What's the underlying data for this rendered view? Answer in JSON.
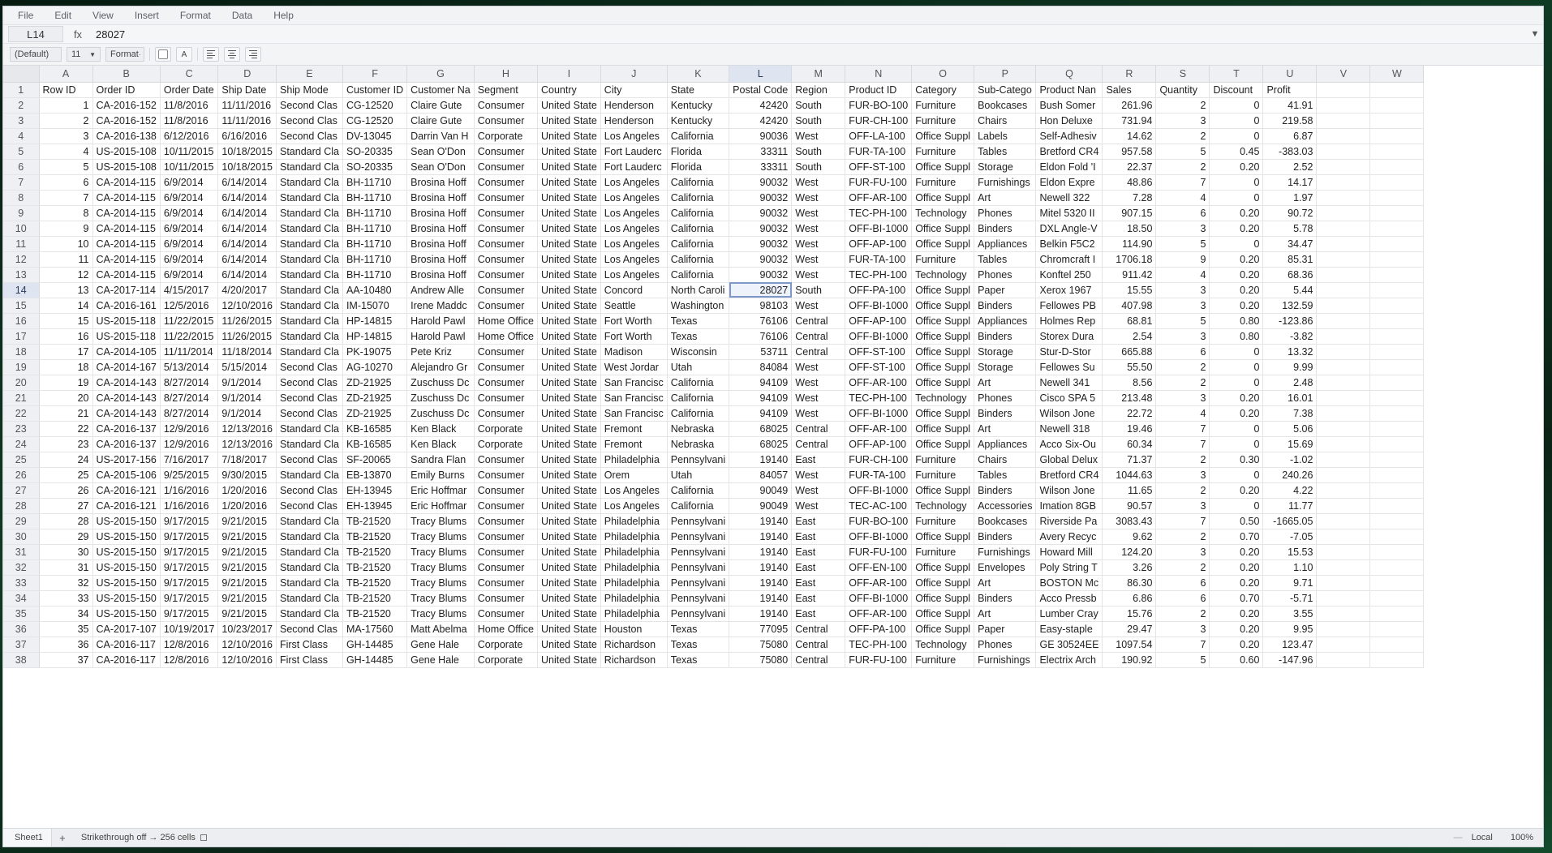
{
  "menu": [
    "File",
    "Edit",
    "View",
    "Insert",
    "Format",
    "Data",
    "Help"
  ],
  "formula_bar": {
    "cell_ref": "L14",
    "fx_label": "fx",
    "value": "28027",
    "collapse_icon": "triangle-down-icon"
  },
  "toolbar": {
    "style_label": "(Default)",
    "font_size": "11",
    "format_label": "Format",
    "color_button": "A"
  },
  "columns": [
    "A",
    "B",
    "C",
    "D",
    "E",
    "F",
    "G",
    "H",
    "I",
    "J",
    "K",
    "L",
    "M",
    "N",
    "O",
    "P",
    "Q",
    "R",
    "S",
    "T",
    "U",
    "V",
    "W"
  ],
  "selected_column": "L",
  "selected_row": 14,
  "header_row": [
    "Row ID",
    "Order ID",
    "Order Date",
    "Ship Date",
    "Ship Mode",
    "Customer ID",
    "Customer Na",
    "Segment",
    "Country",
    "City",
    "State",
    "Postal Code",
    "Region",
    "Product ID",
    "Category",
    "Sub-Catego",
    "Product Nan",
    "Sales",
    "Quantity",
    "Discount",
    "Profit",
    "",
    ""
  ],
  "rows": [
    [
      "1",
      "CA-2016-152",
      "11/8/2016",
      "11/11/2016",
      "Second Clas",
      "CG-12520",
      "Claire Gute",
      "Consumer",
      "United State",
      "Henderson",
      "Kentucky",
      "42420",
      "South",
      "FUR-BO-100",
      "Furniture",
      "Bookcases",
      "Bush Somer",
      "261.96",
      "2",
      "0",
      "41.91"
    ],
    [
      "2",
      "CA-2016-152",
      "11/8/2016",
      "11/11/2016",
      "Second Clas",
      "CG-12520",
      "Claire Gute",
      "Consumer",
      "United State",
      "Henderson",
      "Kentucky",
      "42420",
      "South",
      "FUR-CH-100",
      "Furniture",
      "Chairs",
      "Hon Deluxe",
      "731.94",
      "3",
      "0",
      "219.58"
    ],
    [
      "3",
      "CA-2016-138",
      "6/12/2016",
      "6/16/2016",
      "Second Clas",
      "DV-13045",
      "Darrin Van H",
      "Corporate",
      "United State",
      "Los Angeles",
      "California",
      "90036",
      "West",
      "OFF-LA-100",
      "Office Suppl",
      "Labels",
      "Self-Adhesiv",
      "14.62",
      "2",
      "0",
      "6.87"
    ],
    [
      "4",
      "US-2015-108",
      "10/11/2015",
      "10/18/2015",
      "Standard Cla",
      "SO-20335",
      "Sean O'Don",
      "Consumer",
      "United State",
      "Fort Lauderc",
      "Florida",
      "33311",
      "South",
      "FUR-TA-100",
      "Furniture",
      "Tables",
      "Bretford CR4",
      "957.58",
      "5",
      "0.45",
      "-383.03"
    ],
    [
      "5",
      "US-2015-108",
      "10/11/2015",
      "10/18/2015",
      "Standard Cla",
      "SO-20335",
      "Sean O'Don",
      "Consumer",
      "United State",
      "Fort Lauderc",
      "Florida",
      "33311",
      "South",
      "OFF-ST-100",
      "Office Suppl",
      "Storage",
      "Eldon Fold 'I",
      "22.37",
      "2",
      "0.20",
      "2.52"
    ],
    [
      "6",
      "CA-2014-115",
      "6/9/2014",
      "6/14/2014",
      "Standard Cla",
      "BH-11710",
      "Brosina Hoff",
      "Consumer",
      "United State",
      "Los Angeles",
      "California",
      "90032",
      "West",
      "FUR-FU-100",
      "Furniture",
      "Furnishings",
      "Eldon Expre",
      "48.86",
      "7",
      "0",
      "14.17"
    ],
    [
      "7",
      "CA-2014-115",
      "6/9/2014",
      "6/14/2014",
      "Standard Cla",
      "BH-11710",
      "Brosina Hoff",
      "Consumer",
      "United State",
      "Los Angeles",
      "California",
      "90032",
      "West",
      "OFF-AR-100",
      "Office Suppl",
      "Art",
      "Newell 322",
      "7.28",
      "4",
      "0",
      "1.97"
    ],
    [
      "8",
      "CA-2014-115",
      "6/9/2014",
      "6/14/2014",
      "Standard Cla",
      "BH-11710",
      "Brosina Hoff",
      "Consumer",
      "United State",
      "Los Angeles",
      "California",
      "90032",
      "West",
      "TEC-PH-100",
      "Technology",
      "Phones",
      "Mitel 5320 II",
      "907.15",
      "6",
      "0.20",
      "90.72"
    ],
    [
      "9",
      "CA-2014-115",
      "6/9/2014",
      "6/14/2014",
      "Standard Cla",
      "BH-11710",
      "Brosina Hoff",
      "Consumer",
      "United State",
      "Los Angeles",
      "California",
      "90032",
      "West",
      "OFF-BI-1000",
      "Office Suppl",
      "Binders",
      "DXL Angle-V",
      "18.50",
      "3",
      "0.20",
      "5.78"
    ],
    [
      "10",
      "CA-2014-115",
      "6/9/2014",
      "6/14/2014",
      "Standard Cla",
      "BH-11710",
      "Brosina Hoff",
      "Consumer",
      "United State",
      "Los Angeles",
      "California",
      "90032",
      "West",
      "OFF-AP-100",
      "Office Suppl",
      "Appliances",
      "Belkin F5C2",
      "114.90",
      "5",
      "0",
      "34.47"
    ],
    [
      "11",
      "CA-2014-115",
      "6/9/2014",
      "6/14/2014",
      "Standard Cla",
      "BH-11710",
      "Brosina Hoff",
      "Consumer",
      "United State",
      "Los Angeles",
      "California",
      "90032",
      "West",
      "FUR-TA-100",
      "Furniture",
      "Tables",
      "Chromcraft I",
      "1706.18",
      "9",
      "0.20",
      "85.31"
    ],
    [
      "12",
      "CA-2014-115",
      "6/9/2014",
      "6/14/2014",
      "Standard Cla",
      "BH-11710",
      "Brosina Hoff",
      "Consumer",
      "United State",
      "Los Angeles",
      "California",
      "90032",
      "West",
      "TEC-PH-100",
      "Technology",
      "Phones",
      "Konftel 250",
      "911.42",
      "4",
      "0.20",
      "68.36"
    ],
    [
      "13",
      "CA-2017-114",
      "4/15/2017",
      "4/20/2017",
      "Standard Cla",
      "AA-10480",
      "Andrew Alle",
      "Consumer",
      "United State",
      "Concord",
      "North Caroli",
      "28027",
      "South",
      "OFF-PA-100",
      "Office Suppl",
      "Paper",
      "Xerox 1967",
      "15.55",
      "3",
      "0.20",
      "5.44"
    ],
    [
      "14",
      "CA-2016-161",
      "12/5/2016",
      "12/10/2016",
      "Standard Cla",
      "IM-15070",
      "Irene Maddc",
      "Consumer",
      "United State",
      "Seattle",
      "Washington",
      "98103",
      "West",
      "OFF-BI-1000",
      "Office Suppl",
      "Binders",
      "Fellowes PB",
      "407.98",
      "3",
      "0.20",
      "132.59"
    ],
    [
      "15",
      "US-2015-118",
      "11/22/2015",
      "11/26/2015",
      "Standard Cla",
      "HP-14815",
      "Harold Pawl",
      "Home Office",
      "United State",
      "Fort Worth",
      "Texas",
      "76106",
      "Central",
      "OFF-AP-100",
      "Office Suppl",
      "Appliances",
      "Holmes Rep",
      "68.81",
      "5",
      "0.80",
      "-123.86"
    ],
    [
      "16",
      "US-2015-118",
      "11/22/2015",
      "11/26/2015",
      "Standard Cla",
      "HP-14815",
      "Harold Pawl",
      "Home Office",
      "United State",
      "Fort Worth",
      "Texas",
      "76106",
      "Central",
      "OFF-BI-1000",
      "Office Suppl",
      "Binders",
      "Storex Dura",
      "2.54",
      "3",
      "0.80",
      "-3.82"
    ],
    [
      "17",
      "CA-2014-105",
      "11/11/2014",
      "11/18/2014",
      "Standard Cla",
      "PK-19075",
      "Pete Kriz",
      "Consumer",
      "United State",
      "Madison",
      "Wisconsin",
      "53711",
      "Central",
      "OFF-ST-100",
      "Office Suppl",
      "Storage",
      "Stur-D-Stor",
      "665.88",
      "6",
      "0",
      "13.32"
    ],
    [
      "18",
      "CA-2014-167",
      "5/13/2014",
      "5/15/2014",
      "Second Clas",
      "AG-10270",
      "Alejandro Gr",
      "Consumer",
      "United State",
      "West Jordar",
      "Utah",
      "84084",
      "West",
      "OFF-ST-100",
      "Office Suppl",
      "Storage",
      "Fellowes Su",
      "55.50",
      "2",
      "0",
      "9.99"
    ],
    [
      "19",
      "CA-2014-143",
      "8/27/2014",
      "9/1/2014",
      "Second Clas",
      "ZD-21925",
      "Zuschuss Dc",
      "Consumer",
      "United State",
      "San Francisc",
      "California",
      "94109",
      "West",
      "OFF-AR-100",
      "Office Suppl",
      "Art",
      "Newell 341",
      "8.56",
      "2",
      "0",
      "2.48"
    ],
    [
      "20",
      "CA-2014-143",
      "8/27/2014",
      "9/1/2014",
      "Second Clas",
      "ZD-21925",
      "Zuschuss Dc",
      "Consumer",
      "United State",
      "San Francisc",
      "California",
      "94109",
      "West",
      "TEC-PH-100",
      "Technology",
      "Phones",
      "Cisco SPA 5",
      "213.48",
      "3",
      "0.20",
      "16.01"
    ],
    [
      "21",
      "CA-2014-143",
      "8/27/2014",
      "9/1/2014",
      "Second Clas",
      "ZD-21925",
      "Zuschuss Dc",
      "Consumer",
      "United State",
      "San Francisc",
      "California",
      "94109",
      "West",
      "OFF-BI-1000",
      "Office Suppl",
      "Binders",
      "Wilson Jone",
      "22.72",
      "4",
      "0.20",
      "7.38"
    ],
    [
      "22",
      "CA-2016-137",
      "12/9/2016",
      "12/13/2016",
      "Standard Cla",
      "KB-16585",
      "Ken Black",
      "Corporate",
      "United State",
      "Fremont",
      "Nebraska",
      "68025",
      "Central",
      "OFF-AR-100",
      "Office Suppl",
      "Art",
      "Newell 318",
      "19.46",
      "7",
      "0",
      "5.06"
    ],
    [
      "23",
      "CA-2016-137",
      "12/9/2016",
      "12/13/2016",
      "Standard Cla",
      "KB-16585",
      "Ken Black",
      "Corporate",
      "United State",
      "Fremont",
      "Nebraska",
      "68025",
      "Central",
      "OFF-AP-100",
      "Office Suppl",
      "Appliances",
      "Acco Six-Ou",
      "60.34",
      "7",
      "0",
      "15.69"
    ],
    [
      "24",
      "US-2017-156",
      "7/16/2017",
      "7/18/2017",
      "Second Clas",
      "SF-20065",
      "Sandra Flan",
      "Consumer",
      "United State",
      "Philadelphia",
      "Pennsylvani",
      "19140",
      "East",
      "FUR-CH-100",
      "Furniture",
      "Chairs",
      "Global Delux",
      "71.37",
      "2",
      "0.30",
      "-1.02"
    ],
    [
      "25",
      "CA-2015-106",
      "9/25/2015",
      "9/30/2015",
      "Standard Cla",
      "EB-13870",
      "Emily Burns",
      "Consumer",
      "United State",
      "Orem",
      "Utah",
      "84057",
      "West",
      "FUR-TA-100",
      "Furniture",
      "Tables",
      "Bretford CR4",
      "1044.63",
      "3",
      "0",
      "240.26"
    ],
    [
      "26",
      "CA-2016-121",
      "1/16/2016",
      "1/20/2016",
      "Second Clas",
      "EH-13945",
      "Eric Hoffmar",
      "Consumer",
      "United State",
      "Los Angeles",
      "California",
      "90049",
      "West",
      "OFF-BI-1000",
      "Office Suppl",
      "Binders",
      "Wilson Jone",
      "11.65",
      "2",
      "0.20",
      "4.22"
    ],
    [
      "27",
      "CA-2016-121",
      "1/16/2016",
      "1/20/2016",
      "Second Clas",
      "EH-13945",
      "Eric Hoffmar",
      "Consumer",
      "United State",
      "Los Angeles",
      "California",
      "90049",
      "West",
      "TEC-AC-100",
      "Technology",
      "Accessories",
      "Imation 8GB",
      "90.57",
      "3",
      "0",
      "11.77"
    ],
    [
      "28",
      "US-2015-150",
      "9/17/2015",
      "9/21/2015",
      "Standard Cla",
      "TB-21520",
      "Tracy Blums",
      "Consumer",
      "United State",
      "Philadelphia",
      "Pennsylvani",
      "19140",
      "East",
      "FUR-BO-100",
      "Furniture",
      "Bookcases",
      "Riverside Pa",
      "3083.43",
      "7",
      "0.50",
      "-1665.05"
    ],
    [
      "29",
      "US-2015-150",
      "9/17/2015",
      "9/21/2015",
      "Standard Cla",
      "TB-21520",
      "Tracy Blums",
      "Consumer",
      "United State",
      "Philadelphia",
      "Pennsylvani",
      "19140",
      "East",
      "OFF-BI-1000",
      "Office Suppl",
      "Binders",
      "Avery Recyc",
      "9.62",
      "2",
      "0.70",
      "-7.05"
    ],
    [
      "30",
      "US-2015-150",
      "9/17/2015",
      "9/21/2015",
      "Standard Cla",
      "TB-21520",
      "Tracy Blums",
      "Consumer",
      "United State",
      "Philadelphia",
      "Pennsylvani",
      "19140",
      "East",
      "FUR-FU-100",
      "Furniture",
      "Furnishings",
      "Howard Mill",
      "124.20",
      "3",
      "0.20",
      "15.53"
    ],
    [
      "31",
      "US-2015-150",
      "9/17/2015",
      "9/21/2015",
      "Standard Cla",
      "TB-21520",
      "Tracy Blums",
      "Consumer",
      "United State",
      "Philadelphia",
      "Pennsylvani",
      "19140",
      "East",
      "OFF-EN-100",
      "Office Suppl",
      "Envelopes",
      "Poly String T",
      "3.26",
      "2",
      "0.20",
      "1.10"
    ],
    [
      "32",
      "US-2015-150",
      "9/17/2015",
      "9/21/2015",
      "Standard Cla",
      "TB-21520",
      "Tracy Blums",
      "Consumer",
      "United State",
      "Philadelphia",
      "Pennsylvani",
      "19140",
      "East",
      "OFF-AR-100",
      "Office Suppl",
      "Art",
      "BOSTON Mc",
      "86.30",
      "6",
      "0.20",
      "9.71"
    ],
    [
      "33",
      "US-2015-150",
      "9/17/2015",
      "9/21/2015",
      "Standard Cla",
      "TB-21520",
      "Tracy Blums",
      "Consumer",
      "United State",
      "Philadelphia",
      "Pennsylvani",
      "19140",
      "East",
      "OFF-BI-1000",
      "Office Suppl",
      "Binders",
      "Acco Pressb",
      "6.86",
      "6",
      "0.70",
      "-5.71"
    ],
    [
      "34",
      "US-2015-150",
      "9/17/2015",
      "9/21/2015",
      "Standard Cla",
      "TB-21520",
      "Tracy Blums",
      "Consumer",
      "United State",
      "Philadelphia",
      "Pennsylvani",
      "19140",
      "East",
      "OFF-AR-100",
      "Office Suppl",
      "Art",
      "Lumber Cray",
      "15.76",
      "2",
      "0.20",
      "3.55"
    ],
    [
      "35",
      "CA-2017-107",
      "10/19/2017",
      "10/23/2017",
      "Second Clas",
      "MA-17560",
      "Matt Abelma",
      "Home Office",
      "United State",
      "Houston",
      "Texas",
      "77095",
      "Central",
      "OFF-PA-100",
      "Office Suppl",
      "Paper",
      "Easy-staple",
      "29.47",
      "3",
      "0.20",
      "9.95"
    ],
    [
      "36",
      "CA-2016-117",
      "12/8/2016",
      "12/10/2016",
      "First Class",
      "GH-14485",
      "Gene Hale",
      "Corporate",
      "United State",
      "Richardson",
      "Texas",
      "75080",
      "Central",
      "TEC-PH-100",
      "Technology",
      "Phones",
      "GE 30524EE",
      "1097.54",
      "7",
      "0.20",
      "123.47"
    ],
    [
      "37",
      "CA-2016-117",
      "12/8/2016",
      "12/10/2016",
      "First Class",
      "GH-14485",
      "Gene Hale",
      "Corporate",
      "United State",
      "Richardson",
      "Texas",
      "75080",
      "Central",
      "FUR-FU-100",
      "Furniture",
      "Furnishings",
      "Electrix Arch",
      "190.92",
      "5",
      "0.60",
      "-147.96"
    ]
  ],
  "status": {
    "sheet_tab": "Sheet1",
    "add_sheet": "+",
    "message": "Strikethrough off → 256 cells",
    "locale": "Local",
    "zoom": "100%"
  }
}
